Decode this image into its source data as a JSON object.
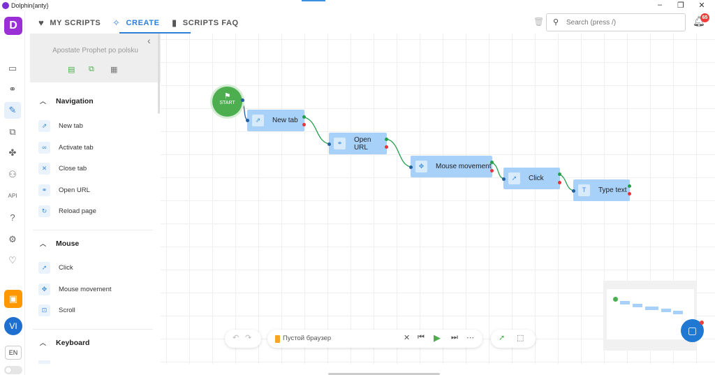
{
  "window": {
    "title": "Dolphin{anty}"
  },
  "rail": {
    "logo": "D",
    "icons": [
      "browser-icon",
      "link-icon",
      "scripts-icon",
      "copy-icon",
      "extensions-icon",
      "users-icon",
      "api-icon",
      "help-icon",
      "settings-icon",
      "idea-icon"
    ],
    "avatar": "VI",
    "lang": "EN"
  },
  "nav": {
    "tabs": [
      {
        "label": "MY SCRIPTS",
        "icon": "heart-icon"
      },
      {
        "label": "CREATE",
        "icon": "sparkle-icon",
        "active": true
      },
      {
        "label": "SCRIPTS FAQ",
        "icon": "book-icon"
      }
    ],
    "search_placeholder": "Search (press /)",
    "notifications": "65"
  },
  "panel": {
    "script_name": "Apostate Prophet po polsku",
    "sections": [
      {
        "title": "Navigation",
        "items": [
          "New tab",
          "Activate tab",
          "Close tab",
          "Open URL",
          "Reload page"
        ]
      },
      {
        "title": "Mouse",
        "items": [
          "Click",
          "Mouse movement",
          "Scroll"
        ]
      },
      {
        "title": "Keyboard",
        "items": []
      }
    ]
  },
  "flow": {
    "start_label": "START",
    "nodes": [
      "New tab",
      "Open URL",
      "Mouse movement",
      "Click",
      "Type text"
    ]
  },
  "player": {
    "browser": "Пустой браузер"
  },
  "colors": {
    "accent": "#2f7fd8",
    "node": "#a7d1f9",
    "start": "#4cae4f",
    "wallet": "#ff9800"
  }
}
